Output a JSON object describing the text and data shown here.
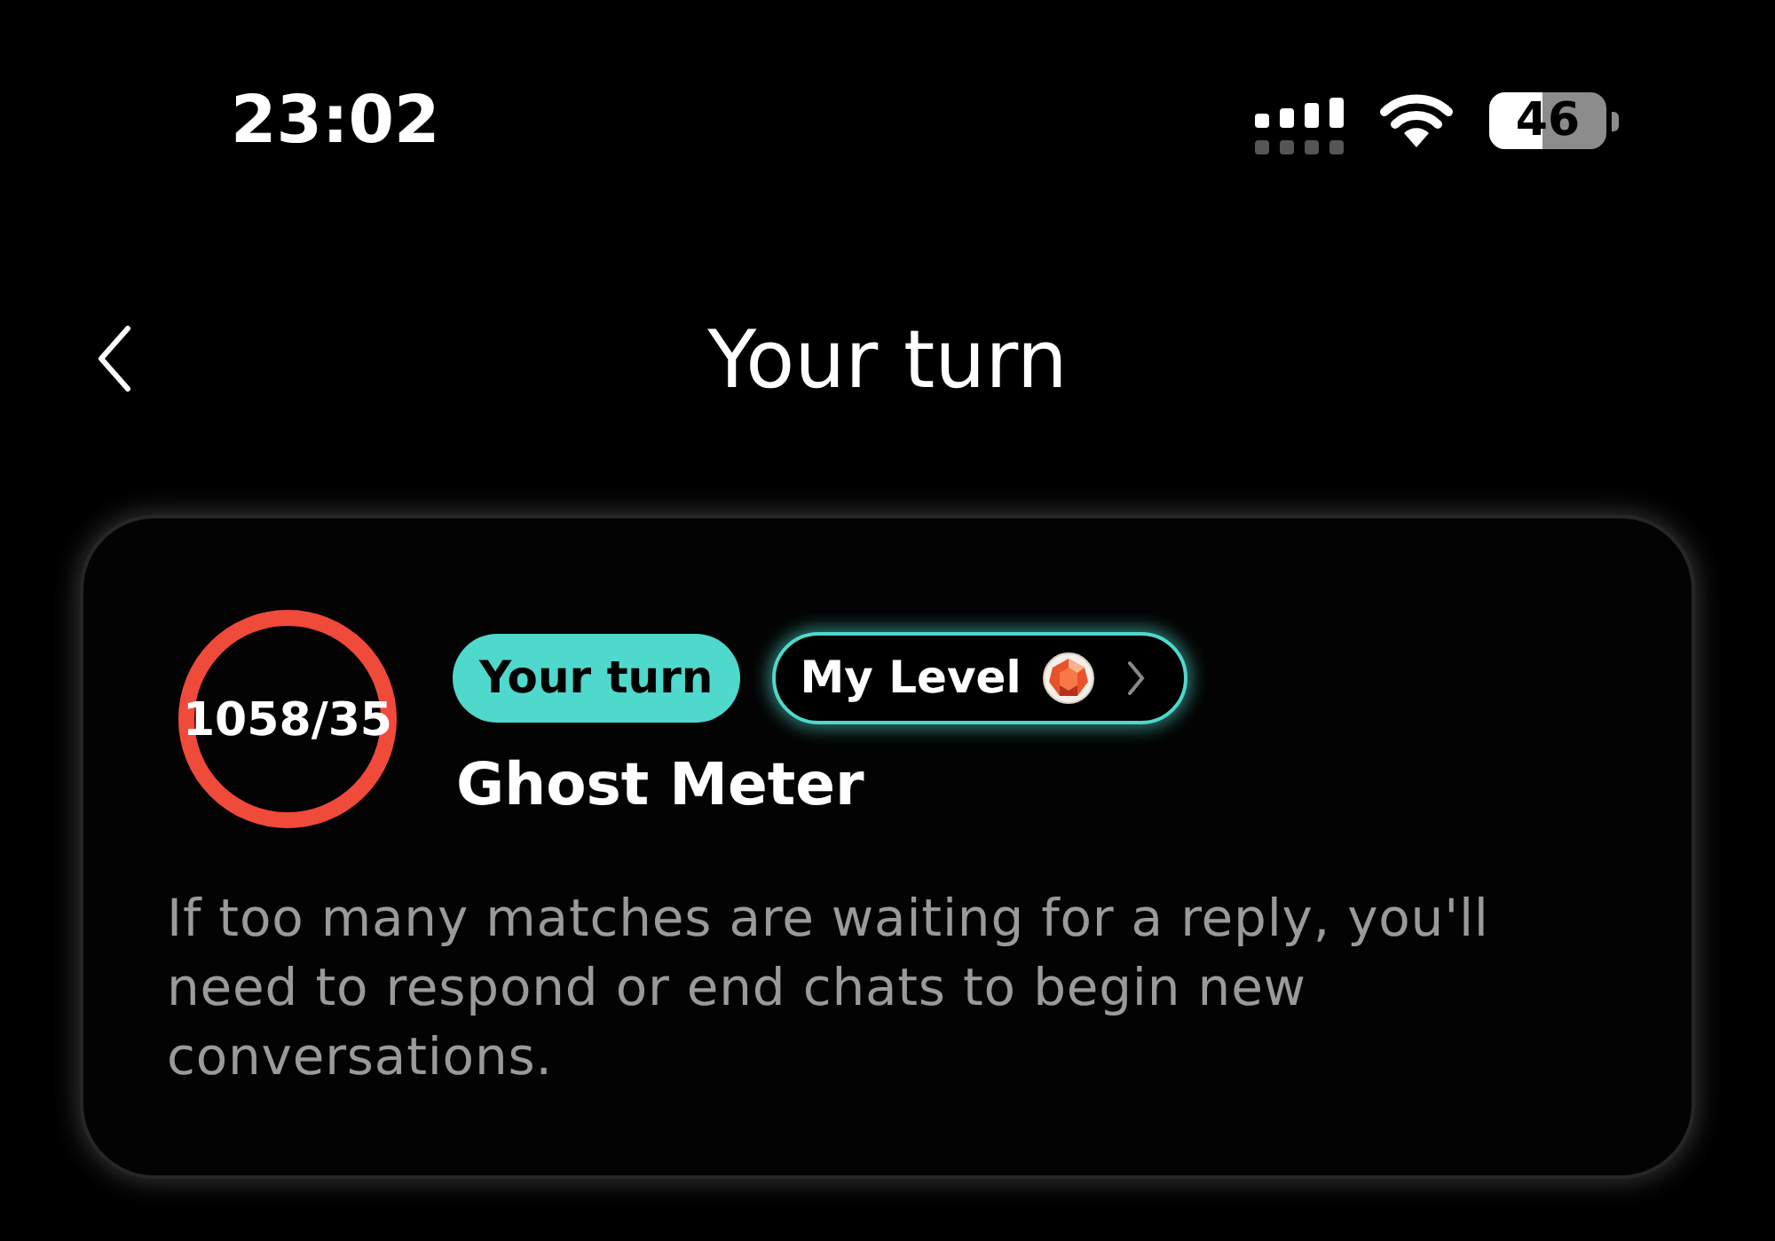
{
  "status_bar": {
    "time": "23:02",
    "battery": "46"
  },
  "nav": {
    "title": "Your turn"
  },
  "card": {
    "meter": {
      "reading": "1058/35",
      "level": 1
    },
    "badge": "Your turn",
    "level_button": {
      "label": "My Level"
    },
    "title": "Ghost Meter",
    "description": "If too many matches are waiting for a reply, you'll need to respond or end chats to begin new conversations."
  }
}
